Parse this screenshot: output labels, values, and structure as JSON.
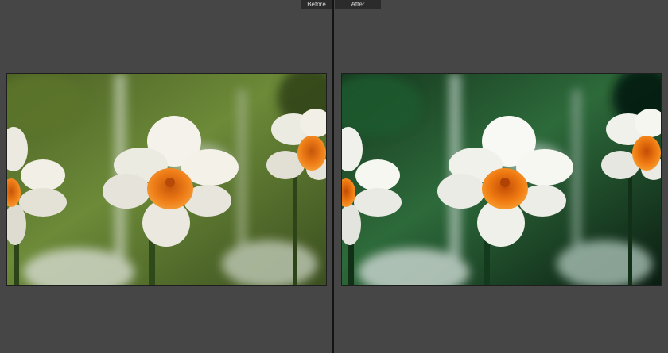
{
  "compare_view": {
    "before_label": "Before",
    "after_label": "After"
  },
  "photos": {
    "before": {
      "subject": "daffodil-flowers",
      "bg_light": "#7f9a49",
      "bg_mid": "#556b2b",
      "bg_dark": "#2a3a17"
    },
    "after": {
      "subject": "daffodil-flowers",
      "bg_light": "#3f7a48",
      "bg_mid": "#235430",
      "bg_dark": "#0a1f12"
    }
  },
  "colors": {
    "panel_bg": "#464646",
    "divider": "#141414",
    "label_bg": "#2b2b2b",
    "label_text": "#d8d8d8",
    "petal": "#f3f1ea",
    "corona": "#ee7a16"
  }
}
